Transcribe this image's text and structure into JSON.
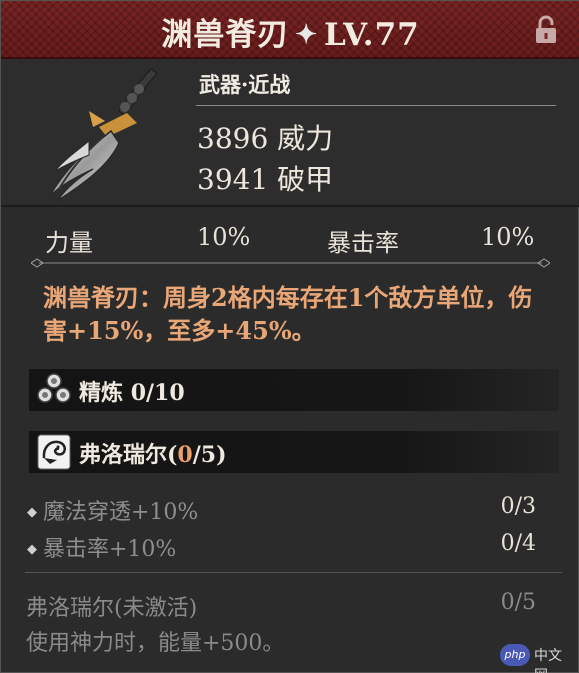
{
  "header": {
    "name": "渊兽脊刃",
    "level": "LV.77"
  },
  "weapon": {
    "type": "武器·近战",
    "power_value": "3896",
    "power_label": "威力",
    "pierce_value": "3941",
    "pierce_label": "破甲"
  },
  "sub_stats": {
    "strength_label": "力量",
    "strength_value": "10%",
    "crit_label": "暴击率",
    "crit_value": "10%"
  },
  "description": "渊兽脊刃：周身2格内每存在1个敌方单位，伤害+15%，至多+45%。",
  "refine": {
    "label": "精炼",
    "value": "0/10"
  },
  "set": {
    "name": "弗洛瑞尔(",
    "current": "0",
    "total": "/5)"
  },
  "bonuses": [
    {
      "label": "魔法穿透+10%",
      "progress": "0/3"
    },
    {
      "label": "暴击率+10%",
      "progress": "0/4"
    }
  ],
  "inactive": {
    "title": "弗洛瑞尔(未激活)",
    "count": "0/5",
    "desc": "使用神力时，能量+500。"
  },
  "watermark": {
    "badge": "php",
    "text": "中文网"
  },
  "colors": {
    "header_red": "#7a2424",
    "description_orange": "#e9a677",
    "inactive_gray": "#8a8a8a",
    "background": "#2b2b2b"
  },
  "icons": [
    "lock-icon",
    "star-icon",
    "refine-icon",
    "floriel-icon",
    "diamond-bullet-icon"
  ]
}
